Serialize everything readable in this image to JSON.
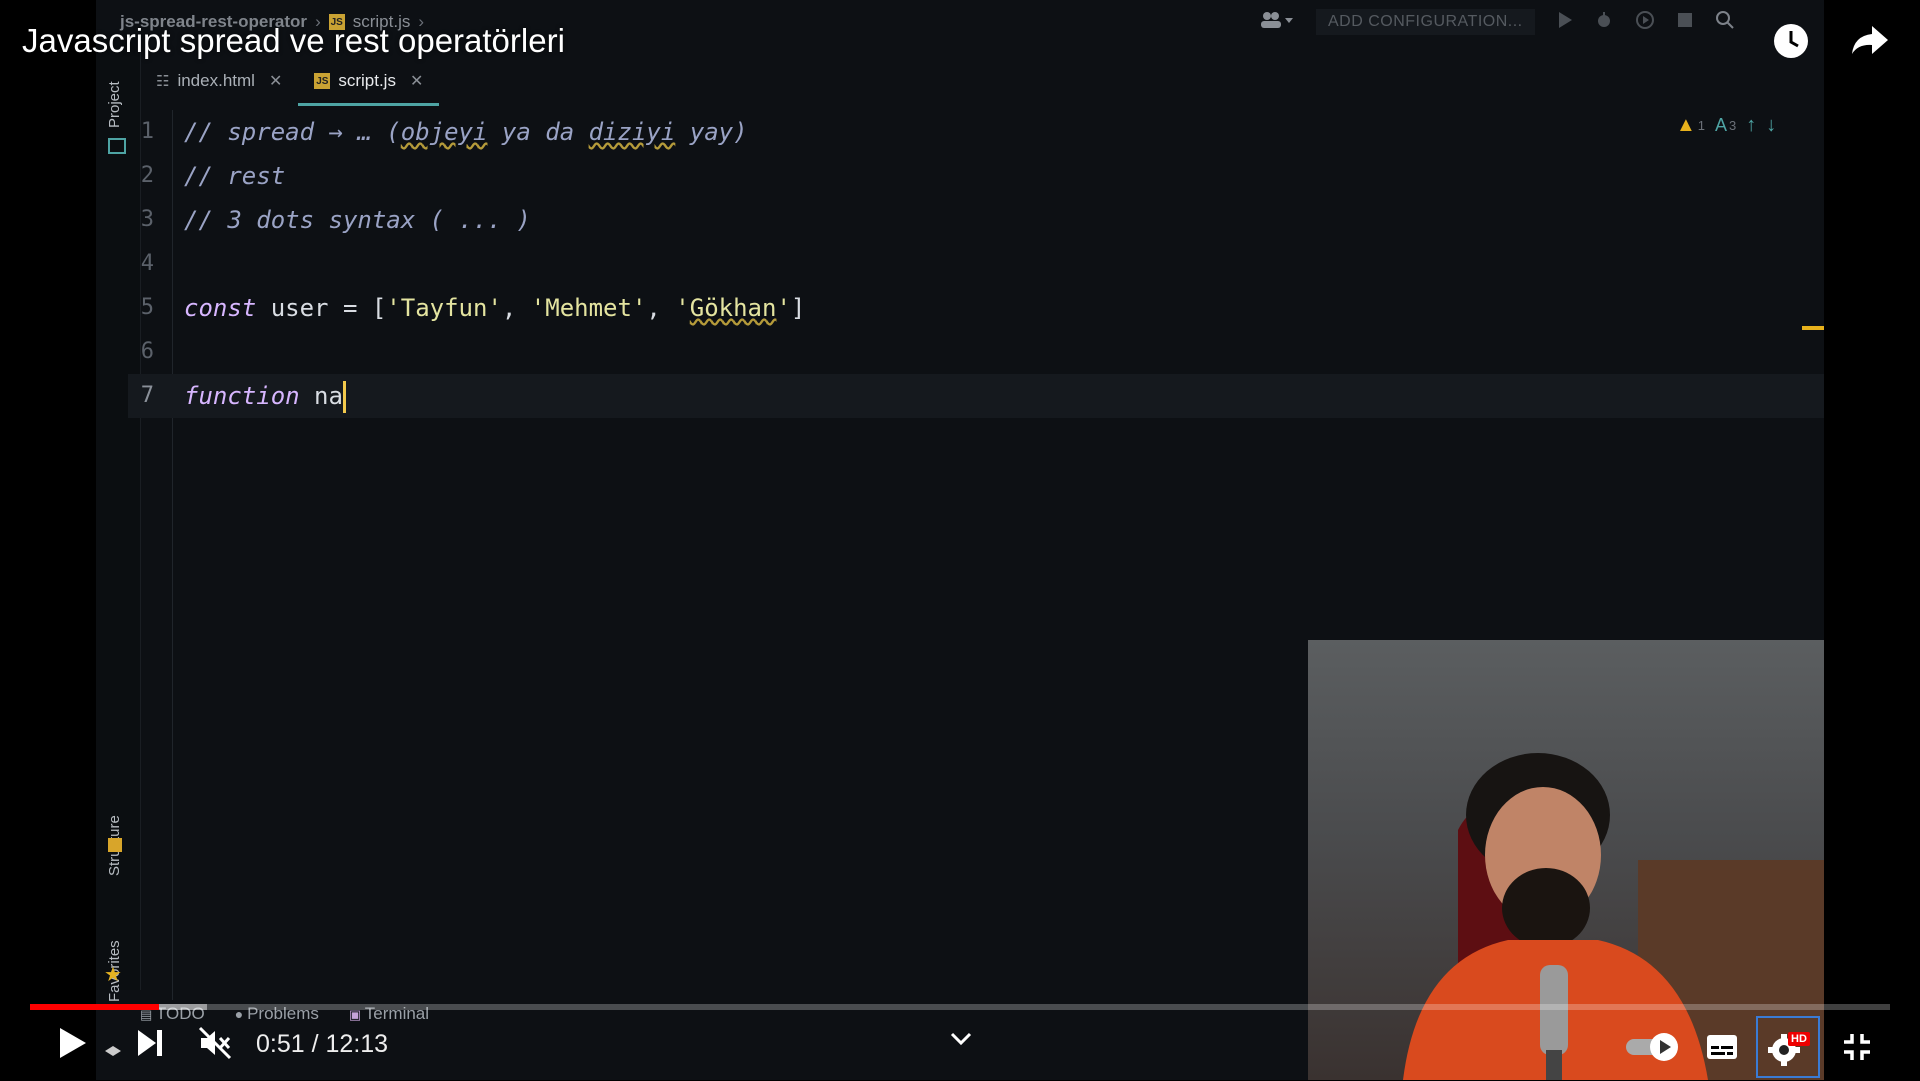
{
  "video": {
    "title": "Javascript spread ve rest operatörleri",
    "time_current": "0:51",
    "time_separator": " / ",
    "time_total": "12:13",
    "progress_fraction": 0.0696,
    "buffered_fraction": 0.095,
    "quality_badge": "HD"
  },
  "ide": {
    "project_name": "js-spread-rest-operator",
    "breadcrumb_file": "script.js",
    "add_configuration_label": "ADD CONFIGURATION...",
    "side_labels": {
      "project": "Project",
      "structure": "Structure",
      "favorites": "Favorites"
    },
    "tabs": [
      {
        "label": "index.html",
        "active": false
      },
      {
        "label": "script.js",
        "active": true
      }
    ],
    "file_icon_text": "JS",
    "inspections": {
      "warnings": "1",
      "typos": "3"
    },
    "lines": [
      {
        "num": "1",
        "tokens": [
          {
            "t": "// spread → … (",
            "c": "cm"
          },
          {
            "t": "objeyi",
            "c": "cm sq"
          },
          {
            "t": " ya da ",
            "c": "cm"
          },
          {
            "t": "diziyi",
            "c": "cm sq"
          },
          {
            "t": " yay)",
            "c": "cm"
          }
        ]
      },
      {
        "num": "2",
        "tokens": [
          {
            "t": "// rest",
            "c": "cm"
          }
        ]
      },
      {
        "num": "3",
        "tokens": [
          {
            "t": "// 3 dots syntax ( ... )",
            "c": "cm"
          }
        ]
      },
      {
        "num": "4",
        "tokens": []
      },
      {
        "num": "5",
        "tokens": [
          {
            "t": "const",
            "c": "kw"
          },
          {
            "t": " user = [",
            "c": "id"
          },
          {
            "t": "'Tayfun'",
            "c": "str"
          },
          {
            "t": ", ",
            "c": "id"
          },
          {
            "t": "'Mehmet'",
            "c": "str"
          },
          {
            "t": ", ",
            "c": "id"
          },
          {
            "t": "'",
            "c": "str"
          },
          {
            "t": "Gökhan",
            "c": "str sq"
          },
          {
            "t": "'",
            "c": "str"
          },
          {
            "t": "]",
            "c": "id"
          }
        ]
      },
      {
        "num": "6",
        "tokens": []
      },
      {
        "num": "7",
        "tokens": [
          {
            "t": "function",
            "c": "kw"
          },
          {
            "t": " na",
            "c": "id"
          }
        ],
        "current": true
      }
    ],
    "tool_tabs": [
      "TODO",
      "Problems",
      "Terminal"
    ]
  },
  "colors": {
    "progress": "#ff0000",
    "accent_tab": "#4ea4a4",
    "warning": "#e8b21c",
    "caret": "#f2c94c"
  },
  "icons": [
    "users-icon",
    "run-icon",
    "debug-icon",
    "profile-icon",
    "stop-icon",
    "search-icon",
    "watch-later-icon",
    "share-icon",
    "play-icon",
    "next-icon",
    "mute-icon",
    "chevron-down-icon",
    "autoplay-toggle",
    "subtitles-icon",
    "settings-icon",
    "exit-fullscreen-icon"
  ]
}
